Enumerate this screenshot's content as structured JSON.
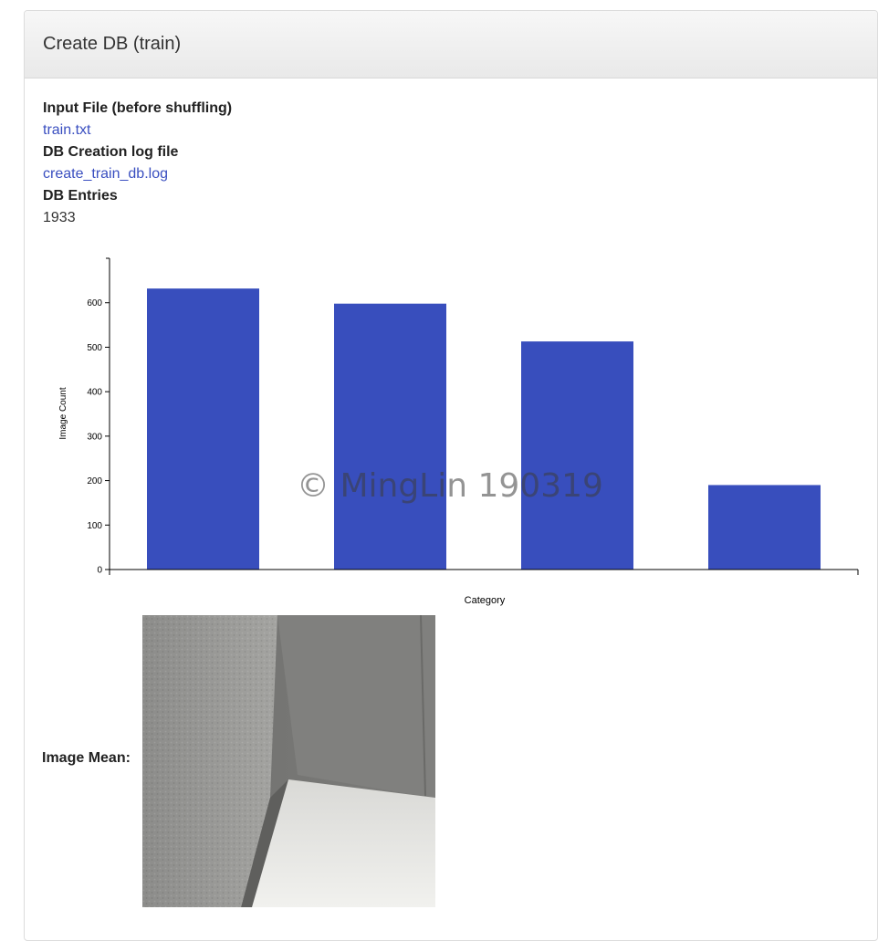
{
  "panel": {
    "title": "Create DB (train)"
  },
  "details": {
    "input_file_label": "Input File (before shuffling)",
    "input_file_link": "train.txt",
    "log_file_label": "DB Creation log file",
    "log_file_link": "create_train_db.log",
    "entries_label": "DB Entries",
    "entries_value": "1933"
  },
  "chart_data": {
    "type": "bar",
    "categories": [
      "",
      "",
      "",
      ""
    ],
    "values": [
      632,
      598,
      513,
      190
    ],
    "xlabel": "Category",
    "ylabel": "Image Count",
    "ylim": [
      0,
      700
    ],
    "yticks": [
      0,
      100,
      200,
      300,
      400,
      500,
      600
    ],
    "bar_color": "#384ebd",
    "grid": false
  },
  "image_mean": {
    "label": "Image Mean:"
  },
  "watermark": "© MingLin 190319"
}
